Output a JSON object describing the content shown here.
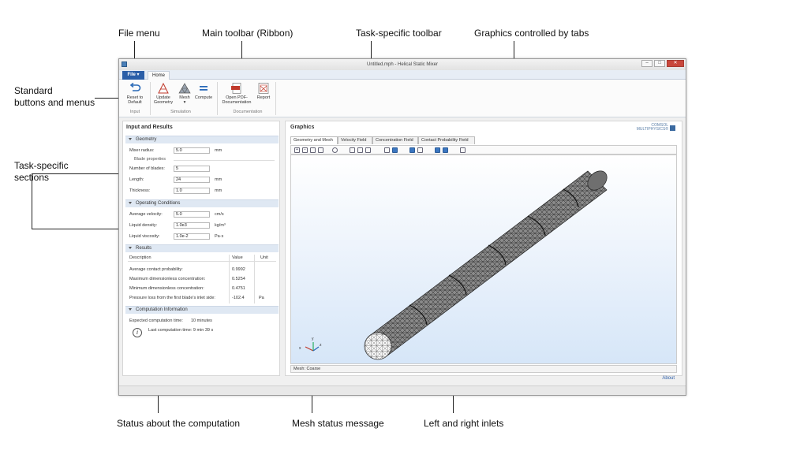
{
  "callouts": {
    "file_menu": "File menu",
    "main_toolbar": "Main toolbar (Ribbon)",
    "task_toolbar": "Task-specific toolbar",
    "graphics_tabs": "Graphics controlled by tabs",
    "standard_buttons_1": "Standard",
    "standard_buttons_2": "buttons and menus",
    "task_sections_1": "Task-specific",
    "task_sections_2": "sections",
    "status_computation": "Status about the computation",
    "mesh_status": "Mesh status message",
    "inlets": "Left and right inlets"
  },
  "window": {
    "title": "Untitled.mph - Helical Static Mixer",
    "minimize": "–",
    "maximize": "□",
    "close": "✕"
  },
  "ribbon": {
    "file_label": "File ▾",
    "home_tab": "Home",
    "reset_line1": "Reset to",
    "reset_line2": "Default",
    "update_line1": "Update",
    "update_line2": "Geometry",
    "mesh_label": "Mesh",
    "mesh_arrow": "▾",
    "compute_label": "Compute",
    "pdf_line1": "Open PDF-",
    "pdf_line2": "Documentation",
    "report_label": "Report",
    "group_input": "Input",
    "group_simulation": "Simulation",
    "group_documentation": "Documentation"
  },
  "left": {
    "title": "Input and Results",
    "geometry": {
      "header": "Geometry",
      "mixer_radius_label": "Mixer radius:",
      "mixer_radius_value": "5.0",
      "mixer_radius_unit": "mm",
      "blade_header": "Blade properties",
      "num_blades_label": "Number of blades:",
      "num_blades_value": "5",
      "length_label": "Length:",
      "length_value": "24",
      "length_unit": "mm",
      "thickness_label": "Thickness:",
      "thickness_value": "1.0",
      "thickness_unit": "mm"
    },
    "operating": {
      "header": "Operating Conditions",
      "velocity_label": "Average velocity:",
      "velocity_value": "5.0",
      "velocity_unit": "cm/s",
      "density_label": "Liquid density:",
      "density_value": "1.0e3",
      "density_unit": "kg/m³",
      "viscosity_label": "Liquid viscosity:",
      "viscosity_value": "1.0e-2",
      "viscosity_unit": "Pa·s"
    },
    "results": {
      "header": "Results",
      "col_description": "Description",
      "col_value": "Value",
      "col_unit": "Unit",
      "rows": [
        {
          "desc": "Average contact probability:",
          "value": "0.9992",
          "unit": ""
        },
        {
          "desc": "Maximum dimensionless concentration:",
          "value": "0.5254",
          "unit": ""
        },
        {
          "desc": "Minimum dimensionless concentration:",
          "value": "0.4751",
          "unit": ""
        },
        {
          "desc": "Pressure loss from the first blade's inlet side:",
          "value": "-102.4",
          "unit": "Pa"
        }
      ]
    },
    "computation": {
      "header": "Computation Information",
      "expected_label": "Expected computation time:",
      "expected_value": "10 minutes",
      "last_label": "Last computation time: 9 min 39 s",
      "info_glyph": "i"
    }
  },
  "graphics": {
    "title": "Graphics",
    "logo_line1": "COMSOL",
    "logo_line2": "MULTIPHYSICS®",
    "tabs": [
      "Geometry and Mesh",
      "Velocity Field",
      "Concentration Field",
      "Contact Probability Field"
    ],
    "mesh_status": "Mesh: Coarse",
    "axis_x": "x",
    "axis_y": "y",
    "axis_z": "z"
  },
  "about": "About",
  "colors": {
    "file_button": "#2a5ea8",
    "accent": "#3b76c0",
    "section_bg": "#dfe8f3"
  }
}
